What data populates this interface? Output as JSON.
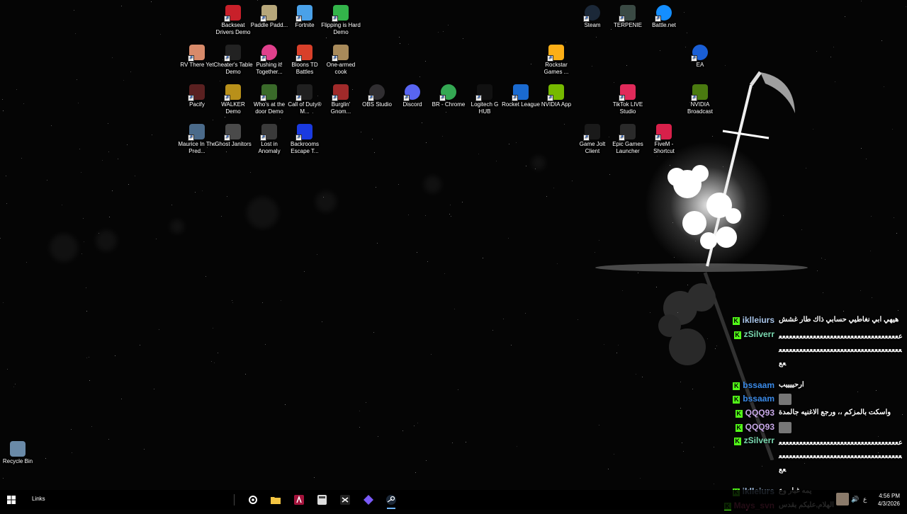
{
  "desktop": {
    "icons": [
      {
        "label": "Backseat Drivers Demo",
        "icon": "car-icon",
        "color": "#c8202a"
      },
      {
        "label": "Paddle Padd...",
        "icon": "paddle-game-icon",
        "color": "#b7a77a"
      },
      {
        "label": "Fortnite",
        "icon": "fortnite-icon",
        "color": "#4aa1e8"
      },
      {
        "label": "Flipping is Hard Demo",
        "icon": "flipping-game-icon",
        "color": "#33b44a"
      },
      {
        "label": "Steam",
        "icon": "steam-icon",
        "color": "#1b2838"
      },
      {
        "label": "TERPENIE",
        "icon": "terpenie-icon",
        "color": "#3a4a44"
      },
      {
        "label": "Battle.net",
        "icon": "battlenet-icon",
        "color": "#148eff"
      },
      {
        "label": "RV There Yet",
        "icon": "rv-game-icon",
        "color": "#d88a6a"
      },
      {
        "label": "Cheater's Table Demo",
        "icon": "cheaters-table-icon",
        "color": "#222222"
      },
      {
        "label": "Pushing it! Together...",
        "icon": "pushing-it-icon",
        "color": "#e0408c"
      },
      {
        "label": "Bloons TD Battles",
        "icon": "bloons-icon",
        "color": "#d8402a"
      },
      {
        "label": "One-armed cook",
        "icon": "cook-game-icon",
        "color": "#a88a5a"
      },
      {
        "label": "Rockstar Games ...",
        "icon": "rockstar-icon",
        "color": "#fcaf17"
      },
      {
        "label": "EA",
        "icon": "ea-icon",
        "color": "#1a5fd6"
      },
      {
        "label": "Pacify",
        "icon": "pacify-icon",
        "color": "#5a2020"
      },
      {
        "label": "WALKER Demo",
        "icon": "walker-icon",
        "color": "#b8901a"
      },
      {
        "label": "Who's at the door Demo",
        "icon": "door-game-icon",
        "color": "#3a6a2a"
      },
      {
        "label": "Call of Duty® M...",
        "icon": "cod-icon",
        "color": "#202020"
      },
      {
        "label": "Burglin' Gnom...",
        "icon": "gnome-icon",
        "color": "#a02a2a"
      },
      {
        "label": "OBS Studio",
        "icon": "obs-icon",
        "color": "#302e31"
      },
      {
        "label": "Discord",
        "icon": "discord-icon",
        "color": "#5865f2"
      },
      {
        "label": "BR - Chrome",
        "icon": "chrome-icon",
        "color": "#34a853"
      },
      {
        "label": "Logitech G HUB",
        "icon": "logitech-icon",
        "color": "#111111"
      },
      {
        "label": "Rocket League",
        "icon": "rocket-league-icon",
        "color": "#1a6ad0"
      },
      {
        "label": "NVIDIA App",
        "icon": "nvidia-icon",
        "color": "#76b900"
      },
      {
        "label": "TikTok LIVE Studio",
        "icon": "tiktok-icon",
        "color": "#e02a5a"
      },
      {
        "label": "NVIDIA Broadcast",
        "icon": "nvidia-broadcast-icon",
        "color": "#4a7a10"
      },
      {
        "label": "Maurice In The Pred...",
        "icon": "maurice-icon",
        "color": "#4a6a8a"
      },
      {
        "label": "Ghost Janitors",
        "icon": "ghost-janitors-icon",
        "color": "#4a4a4a"
      },
      {
        "label": "Lost in Anomaly",
        "icon": "anomaly-icon",
        "color": "#3a3a3a"
      },
      {
        "label": "Backrooms Escape T...",
        "icon": "backrooms-icon",
        "color": "#1a3ae0"
      },
      {
        "label": "Game Jolt Client",
        "icon": "gamejolt-icon",
        "color": "#1a1a1a"
      },
      {
        "label": "Epic Games Launcher",
        "icon": "epic-icon",
        "color": "#2a2a2a"
      },
      {
        "label": "FiveM - Shortcut",
        "icon": "fivem-icon",
        "color": "#d8204a"
      },
      {
        "label": "Recycle Bin",
        "icon": "recycle-bin-icon",
        "color": "#6a8aa8"
      }
    ]
  },
  "chat": {
    "messages": [
      {
        "user": "iklleiurs",
        "color": "#a8c4e8",
        "text": "هيهي ابي نغاطيي حسابي ذاك طار غشش"
      },
      {
        "user": "zSilverr",
        "color": "#7ad8b0",
        "text": "عععععععععععععععععععععععععععععععععععععععععععععععععععععععععععععععععععععععععع"
      },
      {
        "user": "bssaam",
        "color": "#3a8ae8",
        "text": "ارحييييب"
      },
      {
        "user": "bssaam",
        "color": "#3a8ae8",
        "text": ""
      },
      {
        "user": "QQQ93",
        "color": "#c8a8e8",
        "text": "واسكت بالمزكم ،، ورجع الاغنيه جالمدة"
      },
      {
        "user": "QQQ93",
        "color": "#c8a8e8",
        "text": ""
      },
      {
        "user": "zSilverr",
        "color": "#7ad8b0",
        "text": "عععععععععععععععععععععععععععععععععععععععععععععععععععععععععععععععععععععععععع"
      },
      {
        "user": "iklleiurs",
        "color": "#a8c4e8",
        "text": "يمه غبار وع"
      },
      {
        "user": "Mays_svn",
        "color": "#e8508a",
        "text": "الهلام,عليكم بقدس"
      }
    ]
  },
  "taskbar": {
    "links_label": "Links",
    "apps": [
      {
        "icon": "settings-icon"
      },
      {
        "icon": "file-explorer-icon"
      },
      {
        "icon": "adobe-icon"
      },
      {
        "icon": "calculator-icon"
      },
      {
        "icon": "capcut-icon"
      },
      {
        "icon": "linear-app-icon"
      },
      {
        "icon": "steam-icon"
      }
    ],
    "tray_lang": "ع",
    "time": "4:56 PM",
    "date": "4/3/2026"
  }
}
